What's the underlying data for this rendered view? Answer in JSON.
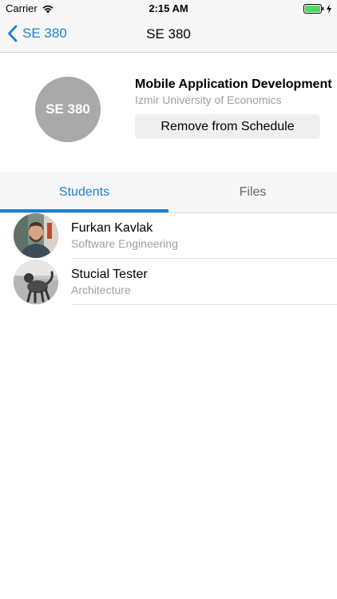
{
  "status_bar": {
    "carrier": "Carrier",
    "time": "2:15 AM",
    "icons": [
      "wifi-icon",
      "battery-icon",
      "charging-icon"
    ]
  },
  "nav": {
    "back_label": "SE 380",
    "title": "SE 380"
  },
  "course": {
    "avatar_text": "SE 380",
    "name": "Mobile Application Development",
    "university": "Izmir University of Economics",
    "remove_label": "Remove from Schedule"
  },
  "tabs": [
    {
      "label": "Students",
      "selected": true
    },
    {
      "label": "Files",
      "selected": false
    }
  ],
  "students": [
    {
      "name": "Furkan Kavlak",
      "department": "Software Engineering"
    },
    {
      "name": "Stucial Tester",
      "department": "Architecture"
    }
  ],
  "colors": {
    "accent": "#1a7fd6",
    "secondary_text": "#a0a0a0",
    "bar_background": "#f7f7f7",
    "course_avatar": "#a9a9a9",
    "battery": "#4cd964"
  }
}
